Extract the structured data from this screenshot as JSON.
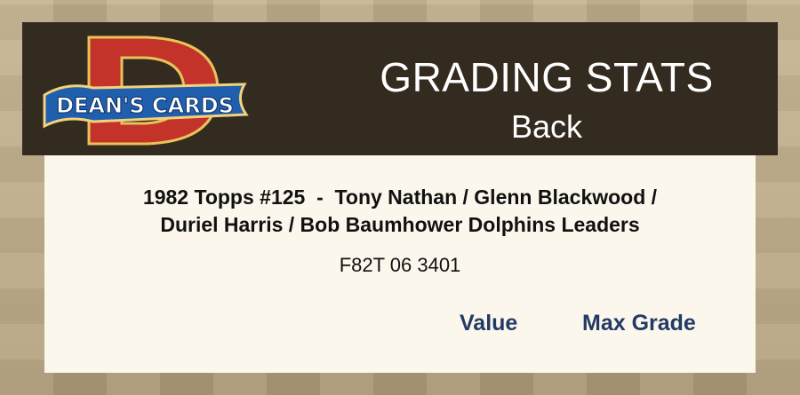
{
  "header": {
    "logo_text": "DEAN'S CARDS",
    "logo_letter": "D",
    "title": "GRADING STATS",
    "subtitle": "Back"
  },
  "card": {
    "name_line1": "1982 Topps #125  -  Tony Nathan / Glenn Blackwood /",
    "name_line2": "Duriel Harris / Bob Baumhower Dolphins Leaders",
    "cert_number": "F82T 06 3401"
  },
  "table": {
    "columns": [
      "Value",
      "Max Grade"
    ]
  },
  "colors": {
    "header_bg": "#332a20",
    "panel_bg": "#fcf7ec",
    "column_header": "#233a64",
    "logo_red": "#c4332a",
    "logo_blue": "#1f5fae"
  }
}
